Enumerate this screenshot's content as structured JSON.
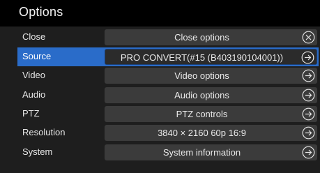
{
  "window": {
    "title": "Options"
  },
  "rows": [
    {
      "id": "close",
      "label": "Close",
      "button": "Close options",
      "icon": "close-icon"
    },
    {
      "id": "source",
      "label": "Source",
      "button": "PRO CONVERT(#15 (B403190104001))",
      "icon": "arrow-right-icon",
      "selected": true
    },
    {
      "id": "video",
      "label": "Video",
      "button": "Video options",
      "icon": "arrow-right-icon"
    },
    {
      "id": "audio",
      "label": "Audio",
      "button": "Audio options",
      "icon": "arrow-right-icon"
    },
    {
      "id": "ptz",
      "label": "PTZ",
      "button": "PTZ controls",
      "icon": "arrow-right-icon"
    },
    {
      "id": "resolution",
      "label": "Resolution",
      "button": "3840 × 2160 60p 16:9",
      "icon": "arrow-right-icon"
    },
    {
      "id": "system",
      "label": "System",
      "button": "System information",
      "icon": "arrow-right-icon"
    }
  ],
  "colors": {
    "background": "#1e1e1e",
    "title_bar": "#000000",
    "selected_row": "#2a6cc9",
    "button": "#3b3b3b",
    "text": "#eaeaea"
  }
}
